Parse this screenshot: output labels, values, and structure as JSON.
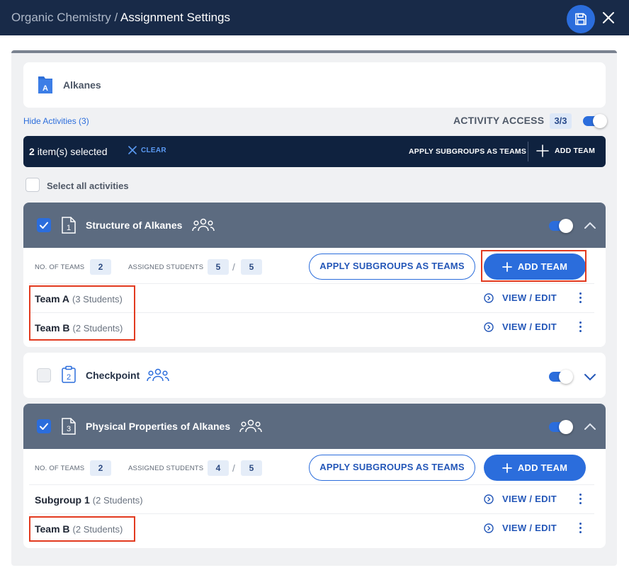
{
  "header": {
    "breadcrumb_course": "Organic Chemistry",
    "breadcrumb_sep": "/",
    "breadcrumb_page": "Assignment Settings",
    "save_icon": "save-icon",
    "close_icon": "close-icon"
  },
  "folder": {
    "name": "Alkanes",
    "icon_letter": "A"
  },
  "toolbar": {
    "hide_activities": "Hide Activities (3)",
    "activity_access_label": "ACTIVITY ACCESS",
    "activity_access_count": "3/3",
    "activity_access_on": true
  },
  "selection_bar": {
    "count": "2",
    "count_suffix": "item(s) selected",
    "clear": "CLEAR",
    "apply_subgroups": "APPLY SUBGROUPS AS TEAMS",
    "add_team": "ADD TEAM"
  },
  "select_all": {
    "label": "Select all activities",
    "checked": false
  },
  "activities": [
    {
      "number": "1",
      "title": "Structure of Alkanes",
      "checked": true,
      "expanded": true,
      "access_on": true,
      "no_of_teams_label": "NO. OF TEAMS",
      "no_of_teams": "2",
      "assigned_label": "ASSIGNED STUDENTS",
      "assigned": "5",
      "assigned_sep": "/",
      "total": "5",
      "apply_btn": "APPLY SUBGROUPS AS TEAMS",
      "add_btn": "ADD TEAM",
      "teams": [
        {
          "name": "Team A",
          "students": "(3 Students)",
          "action": "VIEW / EDIT"
        },
        {
          "name": "Team B",
          "students": "(2 Students)",
          "action": "VIEW / EDIT"
        }
      ]
    },
    {
      "number": "2",
      "title": "Checkpoint",
      "checked": false,
      "expanded": false,
      "access_on": true
    },
    {
      "number": "3",
      "title": "Physical Properties of Alkanes",
      "checked": true,
      "expanded": true,
      "access_on": true,
      "no_of_teams_label": "NO. OF TEAMS",
      "no_of_teams": "2",
      "assigned_label": "ASSIGNED STUDENTS",
      "assigned": "4",
      "assigned_sep": "/",
      "total": "5",
      "apply_btn": "APPLY SUBGROUPS AS TEAMS",
      "add_btn": "ADD TEAM",
      "teams": [
        {
          "name": "Subgroup 1",
          "students": "(2 Students)",
          "action": "VIEW / EDIT"
        },
        {
          "name": "Team B",
          "students": "(2 Students)",
          "action": "VIEW / EDIT"
        }
      ]
    }
  ],
  "colors": {
    "header_bg": "#182a48",
    "accent": "#2b6ddc",
    "selection_bar": "#0f223f",
    "activity_header": "#5c6b80",
    "highlight": "#e23a1f"
  }
}
